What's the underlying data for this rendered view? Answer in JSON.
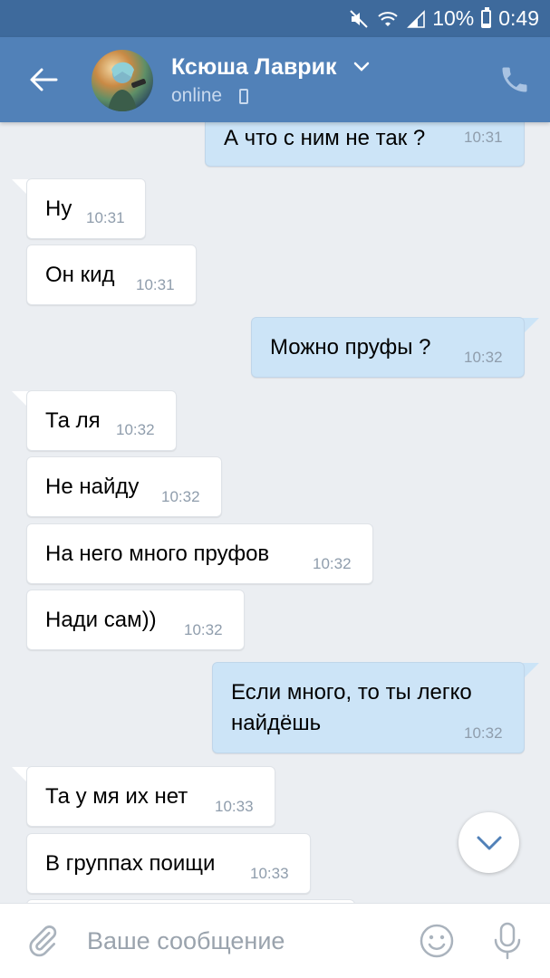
{
  "status_bar": {
    "battery": "10%",
    "time": "0:49",
    "icons": [
      "mute-icon",
      "wifi-icon",
      "signal-icon",
      "battery-icon"
    ]
  },
  "header": {
    "contact_name": "Ксюша Лаврик",
    "status": "online",
    "icons": [
      "back-arrow-icon",
      "chevron-down-icon",
      "mobile-icon",
      "phone-icon"
    ]
  },
  "messages": [
    {
      "dir": "out",
      "text": "А что с ним не так ?",
      "time": "10:31"
    },
    {
      "dir": "in",
      "text": "Ну",
      "time": "10:31"
    },
    {
      "dir": "in",
      "text": "Он кид",
      "time": "10:31"
    },
    {
      "dir": "out",
      "text": "Можно пруфы ?",
      "time": "10:32"
    },
    {
      "dir": "in",
      "text": "Та ля",
      "time": "10:32"
    },
    {
      "dir": "in",
      "text": "Не найду",
      "time": "10:32"
    },
    {
      "dir": "in",
      "text": "На него много пруфов",
      "time": "10:32"
    },
    {
      "dir": "in",
      "text": "Нади сам))",
      "time": "10:32"
    },
    {
      "dir": "out",
      "text": "Если много, то ты легко\nнайдёшь",
      "time": "10:32"
    },
    {
      "dir": "in",
      "text": "Та у мя их нет",
      "time": "10:33"
    },
    {
      "dir": "in",
      "text": "В группах поищи",
      "time": "10:33"
    }
  ],
  "input_bar": {
    "placeholder": "Ваше сообщение",
    "icons": [
      "paperclip-icon",
      "emoji-icon",
      "microphone-icon"
    ]
  },
  "colors": {
    "header": "#5181b8",
    "status_bar": "#3e6a9c",
    "background": "#ebeef2",
    "outgoing_bubble": "#cce4f7",
    "incoming_bubble": "#ffffff"
  }
}
